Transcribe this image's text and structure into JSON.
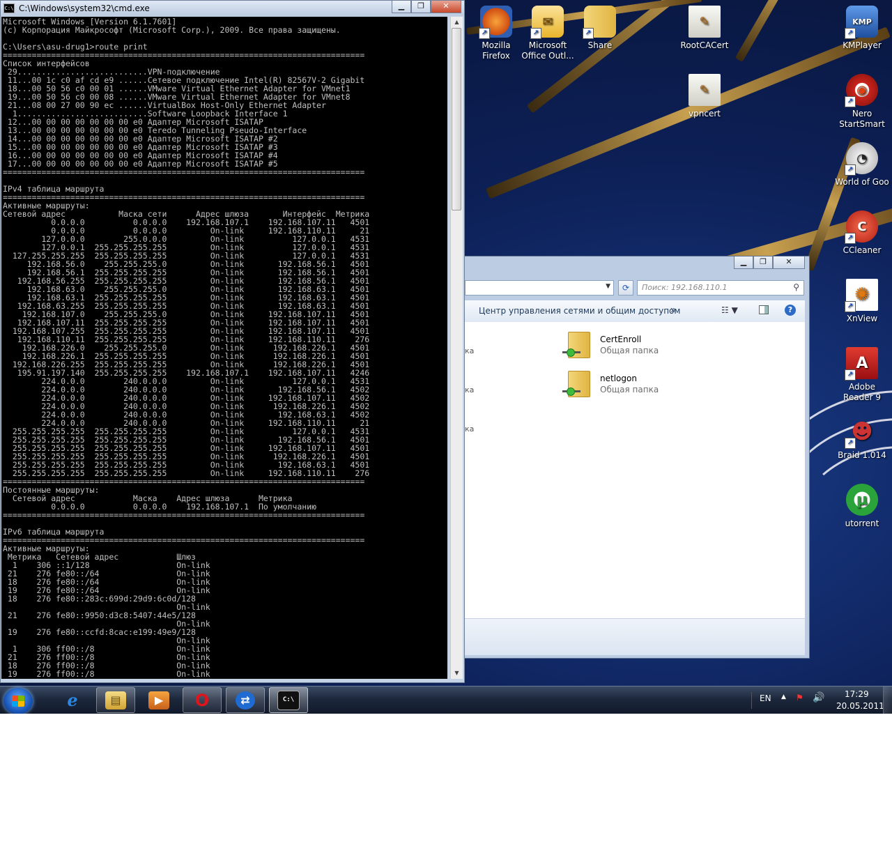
{
  "cmd": {
    "title": "C:\\Windows\\system32\\cmd.exe",
    "icon_text": "C:\\",
    "controls": [
      "minimize-icon",
      "maximize-icon",
      "close-icon"
    ],
    "output": "Microsoft Windows [Version 6.1.7601]\n(c) Корпорация Майкрософт (Microsoft Corp.), 2009. Все права защищены.\n\nC:\\Users\\asu-drug1>route print\n===========================================================================\nСписок интерфейсов\n 29...........................VPN-подключение\n 11...00 1c c0 af cd e9 ......Сетевое подключение Intel(R) 82567V-2 Gigabit\n 18...00 50 56 c0 00 01 ......VMware Virtual Ethernet Adapter for VMnet1\n 19...00 50 56 c0 00 08 ......VMware Virtual Ethernet Adapter for VMnet8\n 21...08 00 27 00 90 ec ......VirtualBox Host-Only Ethernet Adapter\n  1...........................Software Loopback Interface 1\n 12...00 00 00 00 00 00 00 e0 Адаптер Microsoft ISATAP\n 13...00 00 00 00 00 00 00 e0 Teredo Tunneling Pseudo-Interface\n 14...00 00 00 00 00 00 00 e0 Адаптер Microsoft ISATAP #2\n 15...00 00 00 00 00 00 00 e0 Адаптер Microsoft ISATAP #3\n 16...00 00 00 00 00 00 00 e0 Адаптер Microsoft ISATAP #4\n 17...00 00 00 00 00 00 00 e0 Адаптер Microsoft ISATAP #5\n===========================================================================\n\nIPv4 таблица маршрута\n===========================================================================\nАктивные маршруты:\nСетевой адрес           Маска сети      Адрес шлюза       Интерфейс  Метрика\n          0.0.0.0          0.0.0.0    192.168.107.1    192.168.107.11   4501\n          0.0.0.0          0.0.0.0         On-link     192.168.110.11     21\n        127.0.0.0        255.0.0.0         On-link          127.0.0.1   4531\n        127.0.0.1  255.255.255.255         On-link          127.0.0.1   4531\n  127.255.255.255  255.255.255.255         On-link          127.0.0.1   4531\n     192.168.56.0    255.255.255.0         On-link       192.168.56.1   4501\n     192.168.56.1  255.255.255.255         On-link       192.168.56.1   4501\n   192.168.56.255  255.255.255.255         On-link       192.168.56.1   4501\n     192.168.63.0    255.255.255.0         On-link       192.168.63.1   4501\n     192.168.63.1  255.255.255.255         On-link       192.168.63.1   4501\n   192.168.63.255  255.255.255.255         On-link       192.168.63.1   4501\n    192.168.107.0    255.255.255.0         On-link     192.168.107.11   4501\n   192.168.107.11  255.255.255.255         On-link     192.168.107.11   4501\n  192.168.107.255  255.255.255.255         On-link     192.168.107.11   4501\n   192.168.110.11  255.255.255.255         On-link     192.168.110.11    276\n    192.168.226.0    255.255.255.0         On-link      192.168.226.1   4501\n    192.168.226.1  255.255.255.255         On-link      192.168.226.1   4501\n  192.168.226.255  255.255.255.255         On-link      192.168.226.1   4501\n   195.91.197.140  255.255.255.255    192.168.107.1    192.168.107.11   4246\n        224.0.0.0        240.0.0.0         On-link          127.0.0.1   4531\n        224.0.0.0        240.0.0.0         On-link       192.168.56.1   4502\n        224.0.0.0        240.0.0.0         On-link     192.168.107.11   4502\n        224.0.0.0        240.0.0.0         On-link      192.168.226.1   4502\n        224.0.0.0        240.0.0.0         On-link       192.168.63.1   4502\n        224.0.0.0        240.0.0.0         On-link     192.168.110.11     21\n  255.255.255.255  255.255.255.255         On-link          127.0.0.1   4531\n  255.255.255.255  255.255.255.255         On-link       192.168.56.1   4501\n  255.255.255.255  255.255.255.255         On-link     192.168.107.11   4501\n  255.255.255.255  255.255.255.255         On-link      192.168.226.1   4501\n  255.255.255.255  255.255.255.255         On-link       192.168.63.1   4501\n  255.255.255.255  255.255.255.255         On-link     192.168.110.11    276\n===========================================================================\nПостоянные маршруты:\n  Сетевой адрес            Маска    Адрес шлюза      Метрика\n          0.0.0.0          0.0.0.0    192.168.107.1  По умолчанию\n===========================================================================\n\nIPv6 таблица маршрута\n===========================================================================\nАктивные маршруты:\n Метрика   Сетевой адрес            Шлюз\n  1    306 ::1/128                  On-link\n 21    276 fe80::/64                On-link\n 18    276 fe80::/64                On-link\n 19    276 fe80::/64                On-link\n 18    276 fe80::283c:699d:29d9:6c0d/128\n                                    On-link\n 21    276 fe80::9950:d3c8:5407:44e5/128\n                                    On-link\n 19    276 fe80::ccfd:8cac:e199:49e9/128\n                                    On-link\n  1    306 ff00::/8                 On-link\n 21    276 ff00::/8                 On-link\n 18    276 ff00::/8                 On-link\n 19    276 ff00::/8                 On-link"
  },
  "explorer": {
    "search_placeholder": "Поиск: 192.168.110.1",
    "toolbar_label": "Центр управления сетями и общим доступом",
    "toolbar_more": "»",
    "help": "?",
    "nav_fragments": [
      "ка",
      "ка",
      "ка"
    ],
    "items": [
      {
        "name": "CertEnroll",
        "type": "Общая папка"
      },
      {
        "name": "netlogon",
        "type": "Общая папка"
      }
    ]
  },
  "desktop_icons": [
    {
      "label": "Mozilla\nFirefox",
      "icon": "firefox-icon",
      "glyph": "●",
      "color": "#e8761e"
    },
    {
      "label": "Microsoft\nOffice Outl...",
      "icon": "outlook-icon",
      "glyph": "✉",
      "color": "#e9b42b"
    },
    {
      "label": "Share",
      "icon": "share-folder-icon",
      "glyph": "",
      "color": "#e8c75a"
    },
    {
      "label": "RootCACert",
      "icon": "certificate-icon",
      "glyph": "✎",
      "color": "#d8d8d0"
    },
    {
      "label": "KMPlayer",
      "icon": "kmplayer-icon",
      "glyph": "KMP",
      "color": "#2e6fc7"
    },
    {
      "label": "vpncert",
      "icon": "certificate-icon",
      "glyph": "✎",
      "color": "#d8d8d0"
    },
    {
      "label": "Nero\nStartSmart",
      "icon": "nero-icon",
      "glyph": "◉",
      "color": "#c9241c"
    },
    {
      "label": "World of Goo",
      "icon": "world-of-goo-icon",
      "glyph": "◔",
      "color": "#d7d7d7"
    },
    {
      "label": "CCleaner",
      "icon": "ccleaner-icon",
      "glyph": "C",
      "color": "#d33a2a"
    },
    {
      "label": "XnView",
      "icon": "xnview-icon",
      "glyph": "✺",
      "color": "#f0a030"
    },
    {
      "label": "Adobe\nReader 9",
      "icon": "adobe-reader-icon",
      "glyph": "A",
      "color": "#b4141a"
    },
    {
      "label": "Braid 1.014",
      "icon": "braid-icon",
      "glyph": "☻",
      "color": "#a03020"
    },
    {
      "label": "utorrent",
      "icon": "utorrent-icon",
      "glyph": "µ",
      "color": "#2aa33a"
    }
  ],
  "taskbar": {
    "apps": [
      {
        "name": "ie-icon",
        "glyph": "e",
        "color": "#2b86e0"
      },
      {
        "name": "explorer-icon",
        "glyph": "▤",
        "color": "#d9b44a"
      },
      {
        "name": "media-player-icon",
        "glyph": "▶",
        "color": "#e07a1e"
      },
      {
        "name": "opera-icon",
        "glyph": "O",
        "color": "#d4141a"
      },
      {
        "name": "teamviewer-icon",
        "glyph": "⇄",
        "color": "#1f6bd1"
      },
      {
        "name": "cmd-icon",
        "glyph": "C:\\",
        "color": "#111111"
      }
    ],
    "language": "EN",
    "time": "17:29",
    "date": "20.05.2011"
  }
}
